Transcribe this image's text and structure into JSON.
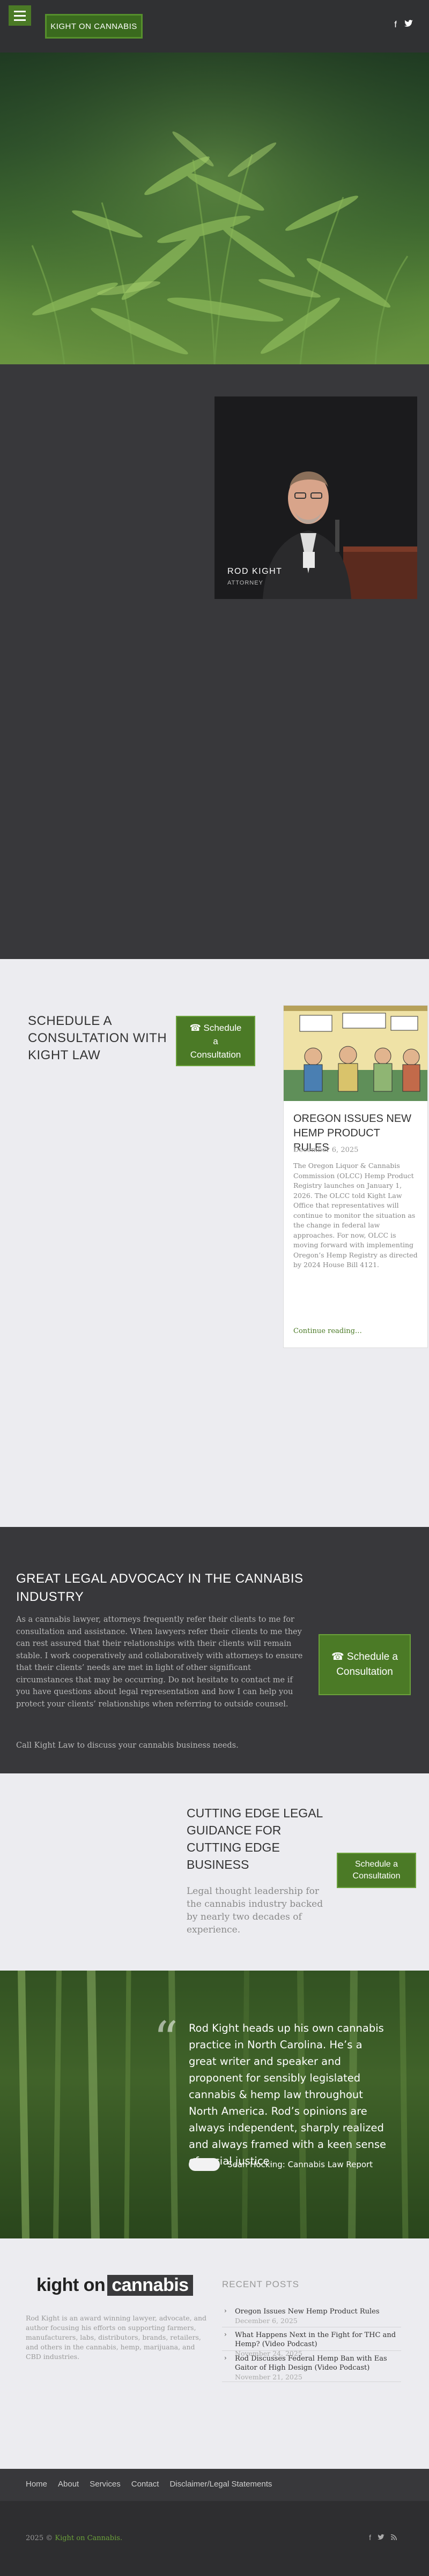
{
  "header": {
    "logo_text": "KIGHT ON CANNABIS",
    "social": {
      "facebook": "f",
      "twitter": "🐦"
    }
  },
  "hero": {
    "image": "cannabis plants foliage"
  },
  "profile": {
    "name": "ROD KIGHT",
    "role": "ATTORNEY"
  },
  "schedule": {
    "heading": "SCHEDULE A CONSULTATION WITH KIGHT LAW",
    "button_icon": "phone-icon",
    "button_label": "☎ Schedule a Consultation"
  },
  "news": {
    "title": "OREGON ISSUES NEW HEMP PRODUCT RULES",
    "date": "December 6, 2025",
    "excerpt": "The Oregon Liquor & Cannabis Commission (OLCC) Hemp Product Registry launches on January 1, 2026. The OLCC told Kight Law Office that representatives will continue to monitor the situation as the change in federal law approaches. For now, OLCC is moving forward with implementing Oregon’s Hemp Registry as directed by 2024 House Bill 4121.",
    "more": "Continue reading…"
  },
  "advocacy": {
    "heading": "GREAT LEGAL ADVOCACY IN THE CANNABIS INDUSTRY",
    "body": "As a cannabis lawyer, attorneys frequently refer their clients to me for consultation and assistance. When lawyers refer their clients to me they can rest assured that their relationships with their clients will remain stable. I work cooperatively and collaboratively with attorneys to ensure that their clients’ needs are met in light of other significant circumstances that may be occurring. Do not hesitate to contact me if you have questions about legal representation and how I can help you protect your clients’ relationships when referring to outside counsel.",
    "call": "Call Kight Law to discuss your cannabis business needs.",
    "button_label": "☎ Schedule a Consultation"
  },
  "cutting_edge": {
    "heading": "CUTTING EDGE LEGAL GUIDANCE FOR CUTTING EDGE BUSINESS",
    "body": "Legal thought leadership for the cannabis industry backed by nearly two decades of experience.",
    "button_label": "Schedule a Consultation"
  },
  "testimonial": {
    "quote": "Rod Kight heads up his own cannabis practice in North Carolina. He’s a great writer and speaker and proponent for sensibly legislated cannabis & hemp law throughout North America. Rod’s opinions are always independent, sharply realized and always framed with a keen sense of social justice.",
    "author": "Sean Hocking: Cannabis Law Report"
  },
  "footer": {
    "logo_part1": "kight on",
    "logo_part2": "cannabis",
    "about": "Rod Kight is an award winning lawyer, advocate, and author focusing his efforts on supporting farmers, manufacturers, labs, distributors, brands, retailers, and others in the cannabis, hemp, marijuana, and CBD industries.",
    "recent_heading": "RECENT POSTS",
    "recent_posts": [
      {
        "title": "Oregon Issues New Hemp Product Rules",
        "date": "December 6, 2025"
      },
      {
        "title": "What Happens Next in the Fight for THC and Hemp? (Video Podcast)",
        "date": "November 24, 2025"
      },
      {
        "title": "Rod Discusses Federal Hemp Ban with Eas Gaitor of High Design (Video Podcast)",
        "date": "November 21, 2025"
      }
    ],
    "nav": [
      "Home",
      "About",
      "Services",
      "Contact",
      "Disclaimer/Legal Statements"
    ],
    "copyright_prefix": "2025 ©",
    "copyright_link": "Kight on Cannabis.",
    "social_bottom": {
      "facebook": "f",
      "twitter": "🐦",
      "rss": "⌂"
    }
  }
}
